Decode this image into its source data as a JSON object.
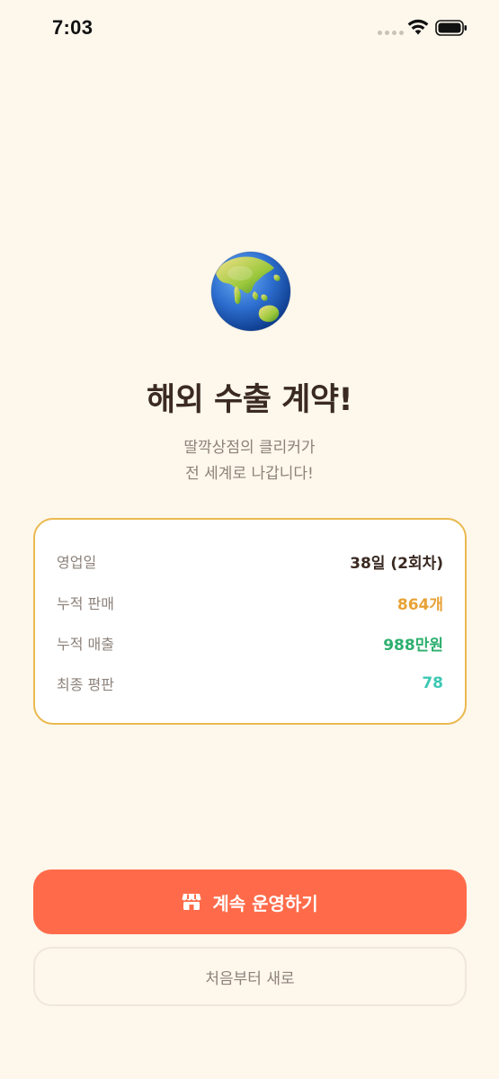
{
  "status_bar": {
    "time": "7:03"
  },
  "icons": {
    "hero": "globe-asia-australia-icon",
    "button": "shop-icon"
  },
  "main": {
    "title": "해외 수출 계약!",
    "subtitle_line1": "딸깍상점의 클리커가",
    "subtitle_line2": "전 세계로 나갑니다!"
  },
  "stats": [
    {
      "label": "영업일",
      "value": "38일 (2회차)",
      "color": "#3A2A22"
    },
    {
      "label": "누적 판매",
      "value": "864개",
      "color": "#E8A235"
    },
    {
      "label": "누적 매출",
      "value": "988만원",
      "color": "#2DAF6E"
    },
    {
      "label": "최종 평판",
      "value": "78",
      "color": "#3CC8B4"
    }
  ],
  "buttons": {
    "continue_label": "계속 운영하기",
    "restart_label": "처음부터 새로"
  },
  "colors": {
    "background": "#FDF7EC",
    "accent": "#FF6B4A",
    "card_border": "#EAB94F"
  }
}
